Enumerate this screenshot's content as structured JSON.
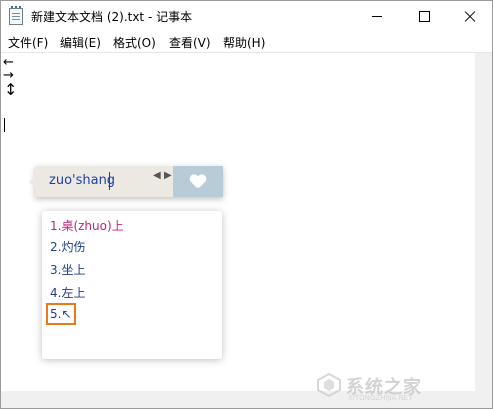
{
  "window": {
    "title": "新建文本文档 (2).txt - 记事本"
  },
  "menu": {
    "items": [
      "文件(F)",
      "编辑(E)",
      "格式(O)",
      "查看(V)",
      "帮助(H)"
    ]
  },
  "ime": {
    "input": "zuo'shang"
  },
  "candidates": [
    "1.桌(zhuo)上",
    "2.灼伤",
    "3.坐上",
    "4.左上",
    "5.↖"
  ],
  "watermark": {
    "text": "系统之家",
    "sub": "XITONGZHIJIA.NET"
  },
  "colors": {
    "candidate_highlight": "#c0247a",
    "candidate_text": "#1f3f8a",
    "annotation_box": "#e87a1a",
    "ime_button": "#b7ccd6"
  }
}
